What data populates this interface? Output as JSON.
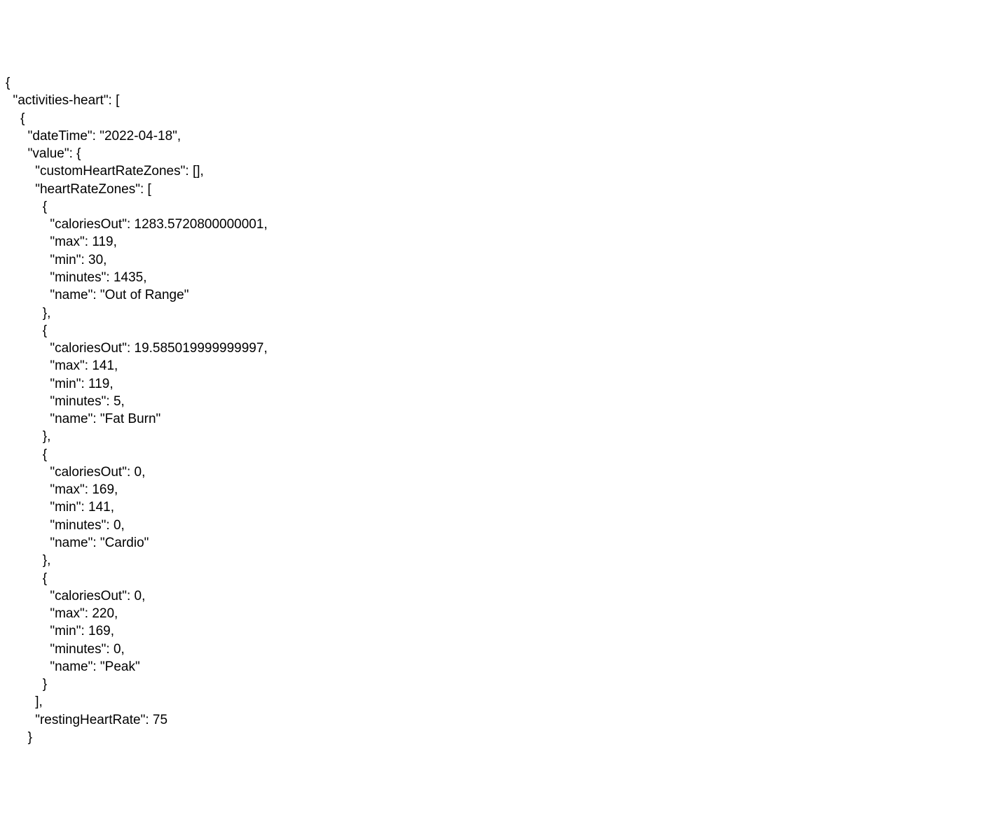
{
  "json_display": {
    "activities-heart": [
      {
        "dateTime": "2022-04-18",
        "value": {
          "customHeartRateZones": [],
          "heartRateZones": [
            {
              "caloriesOut": "1283.5720800000001",
              "max": 119,
              "min": 30,
              "minutes": 1435,
              "name": "Out of Range"
            },
            {
              "caloriesOut": "19.585019999999997",
              "max": 141,
              "min": 119,
              "minutes": 5,
              "name": "Fat Burn"
            },
            {
              "caloriesOut": 0,
              "max": 169,
              "min": 141,
              "minutes": 0,
              "name": "Cardio"
            },
            {
              "caloriesOut": 0,
              "max": 220,
              "min": 169,
              "minutes": 0,
              "name": "Peak"
            }
          ],
          "restingHeartRate": 75
        }
      }
    ]
  },
  "labels": {
    "activities_heart_key": "activities-heart",
    "dateTime_key": "dateTime",
    "dateTime_value": "2022-04-18",
    "value_key": "value",
    "customHeartRateZones_key": "customHeartRateZones",
    "heartRateZones_key": "heartRateZones",
    "caloriesOut_key": "caloriesOut",
    "max_key": "max",
    "min_key": "min",
    "minutes_key": "minutes",
    "name_key": "name",
    "restingHeartRate_key": "restingHeartRate",
    "zone0_caloriesOut": "1283.5720800000001",
    "zone0_max": "119",
    "zone0_min": "30",
    "zone0_minutes": "1435",
    "zone0_name": "Out of Range",
    "zone1_caloriesOut": "19.585019999999997",
    "zone1_max": "141",
    "zone1_min": "119",
    "zone1_minutes": "5",
    "zone1_name": "Fat Burn",
    "zone2_caloriesOut": "0",
    "zone2_max": "169",
    "zone2_min": "141",
    "zone2_minutes": "0",
    "zone2_name": "Cardio",
    "zone3_caloriesOut": "0",
    "zone3_max": "220",
    "zone3_min": "169",
    "zone3_minutes": "0",
    "zone3_name": "Peak",
    "restingHeartRate_value": "75"
  }
}
